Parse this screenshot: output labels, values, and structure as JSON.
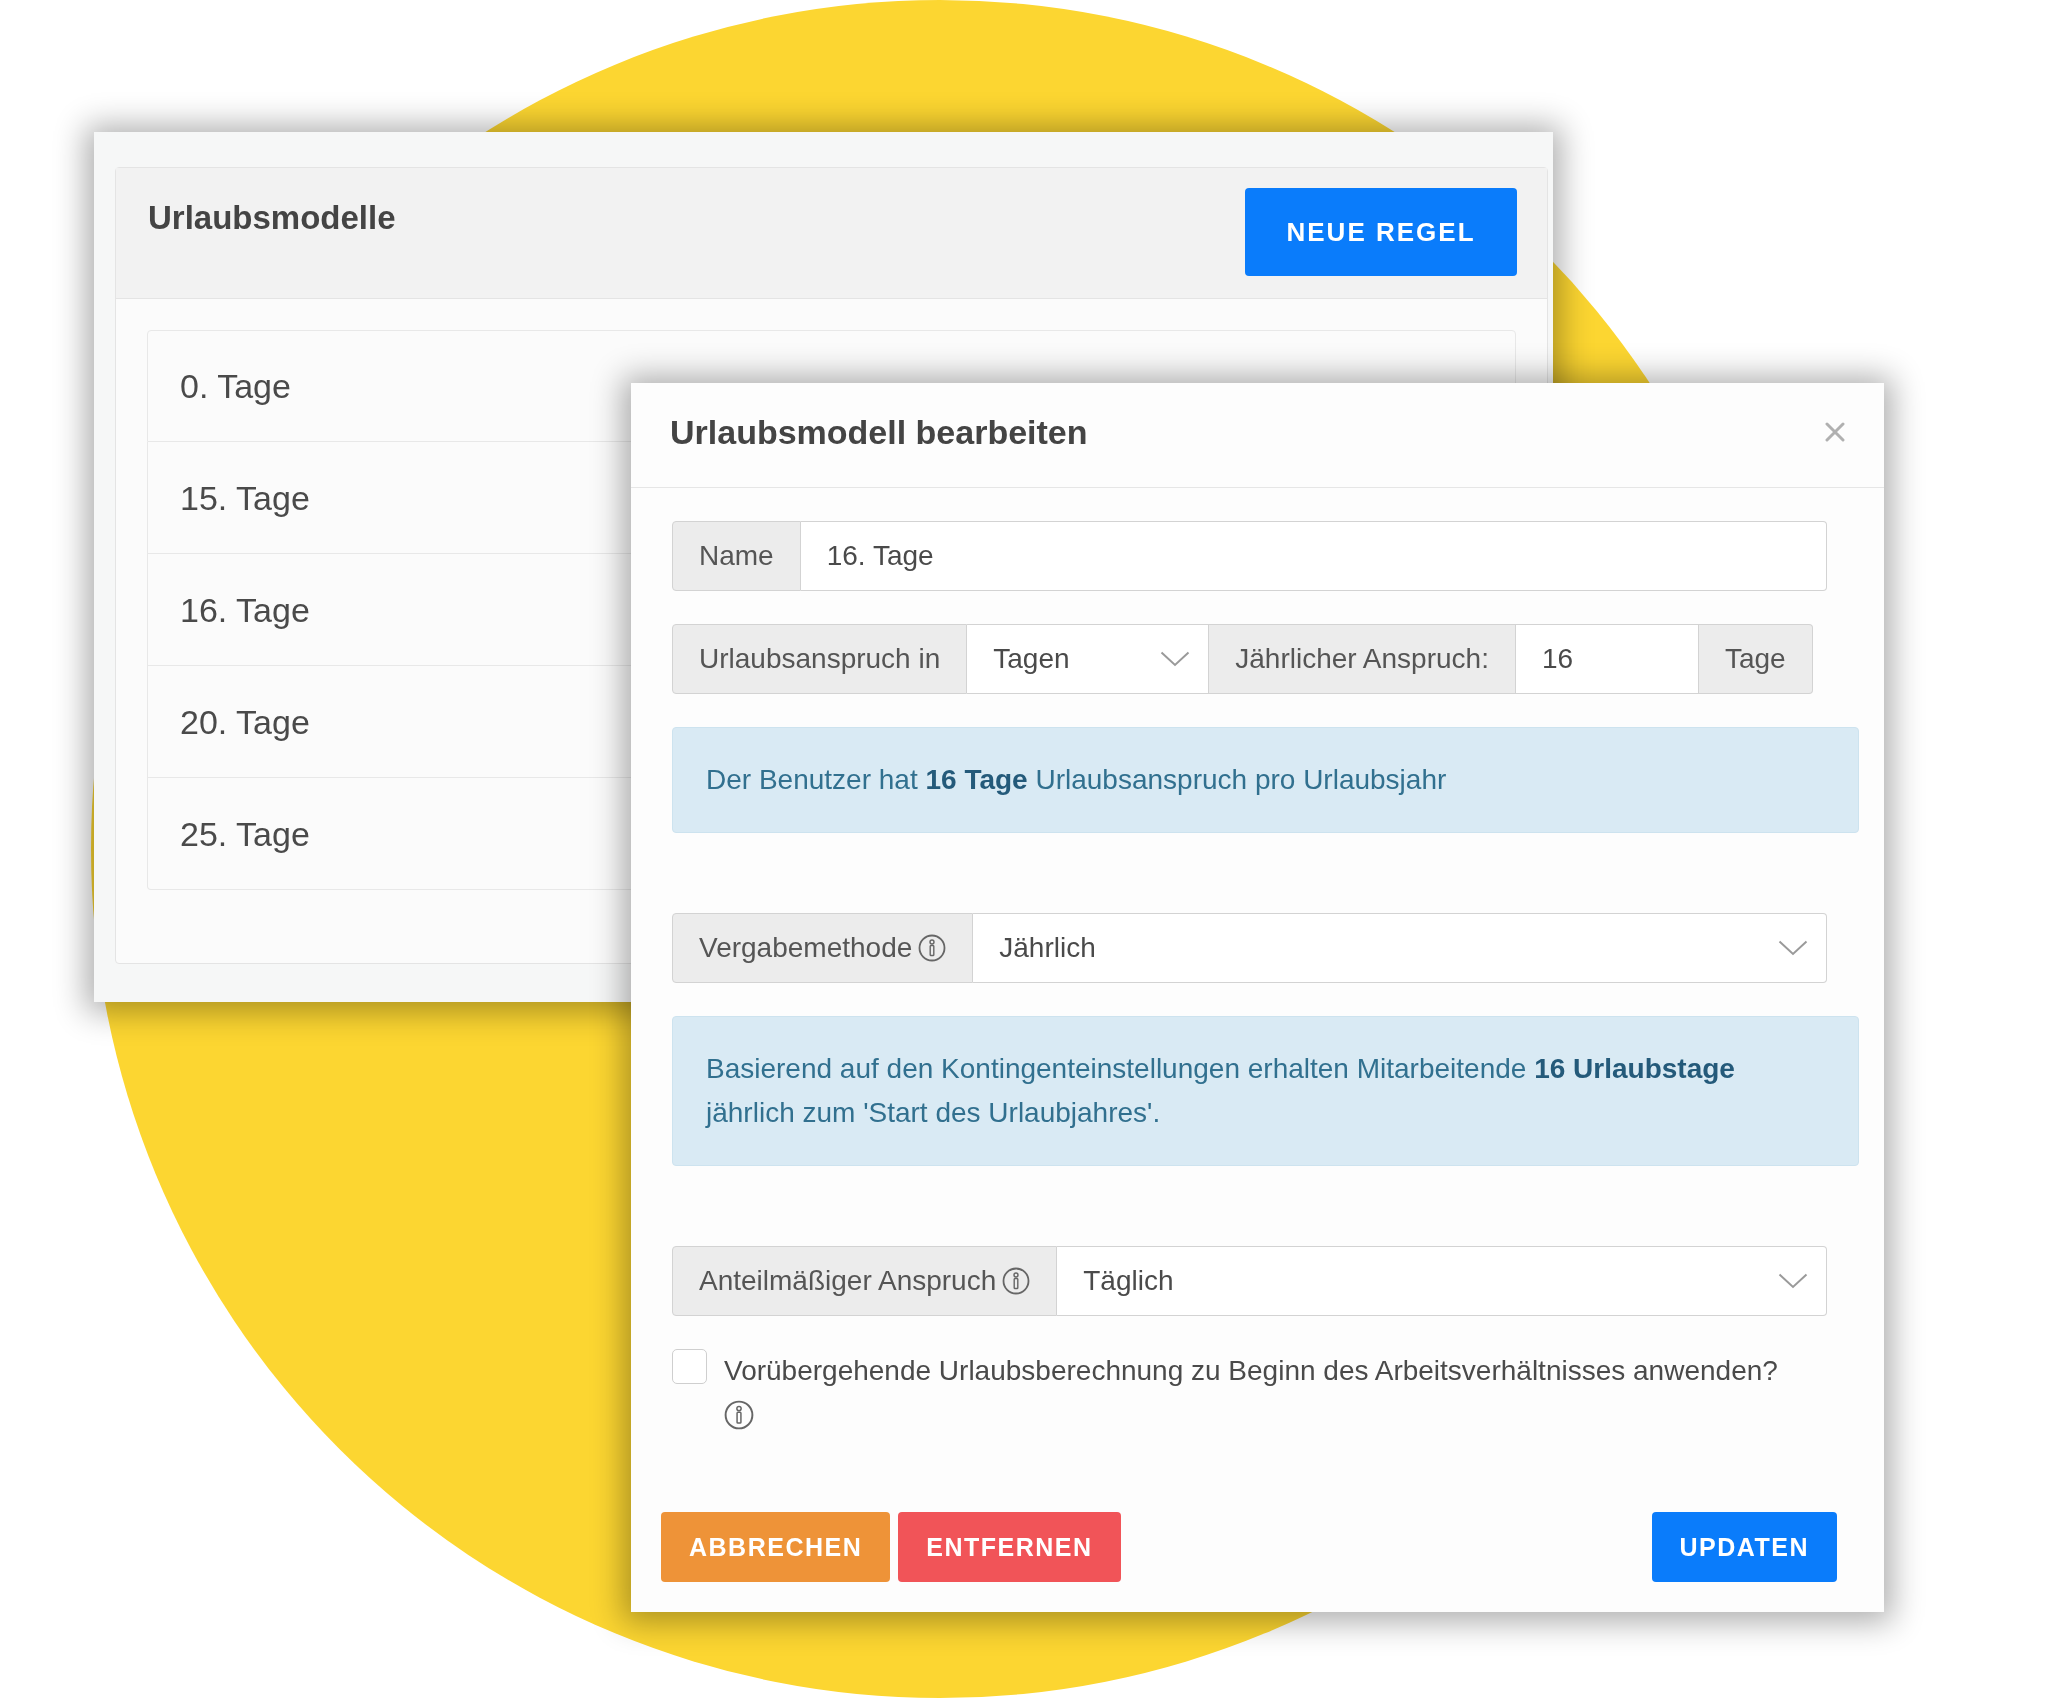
{
  "background_panel": {
    "title": "Urlaubsmodelle",
    "button": "NEUE REGEL",
    "items": [
      "0. Tage",
      "15. Tage",
      "16. Tage",
      "20. Tage",
      "25. Tage"
    ]
  },
  "dialog": {
    "title": "Urlaubsmodell bearbeiten",
    "rows": [
      {
        "kind": "group",
        "parts": [
          {
            "kind": "addon",
            "text": "Name",
            "info": false
          },
          {
            "kind": "input",
            "value": "16. Tage"
          }
        ]
      },
      {
        "kind": "group",
        "parts": [
          {
            "kind": "addon",
            "text": "Urlaubsanspruch in",
            "info": false
          },
          {
            "kind": "select",
            "value": "Tagen"
          },
          {
            "kind": "addon",
            "text": "Jährlicher Anspruch:",
            "info": false
          },
          {
            "kind": "input",
            "value": "16"
          },
          {
            "kind": "addon",
            "text": "Tage",
            "info": false
          }
        ]
      },
      {
        "kind": "alert",
        "text": "Der Benutzer hat **16 Tage** Urlaubsanspruch pro Urlaubsjahr"
      },
      {
        "kind": "group",
        "parts": [
          {
            "kind": "addon",
            "text": "Vergabemethode",
            "info": true
          },
          {
            "kind": "select",
            "value": "Jährlich"
          }
        ]
      },
      {
        "kind": "alert",
        "text": "Basierend auf den Kontingenteinstellungen erhalten Mitarbeitende **16 Urlaubstage** jährlich zum 'Start des Urlaubjahres'."
      },
      {
        "kind": "group",
        "parts": [
          {
            "kind": "addon",
            "text": "Anteilmäßiger Anspruch",
            "info": true
          },
          {
            "kind": "select",
            "value": "Täglich"
          }
        ]
      },
      {
        "kind": "checkbox",
        "label": "Vorübergehende Urlaubsberechnung zu Beginn des Arbeitsverhältnisses anwenden?",
        "checked": false,
        "info": true
      }
    ],
    "buttons": [
      {
        "label": "ABBRECHEN",
        "kind": "cancel"
      },
      {
        "label": "ENTFERNEN",
        "kind": "delete"
      },
      {
        "label": "UPDATEN",
        "kind": "primary"
      }
    ]
  }
}
